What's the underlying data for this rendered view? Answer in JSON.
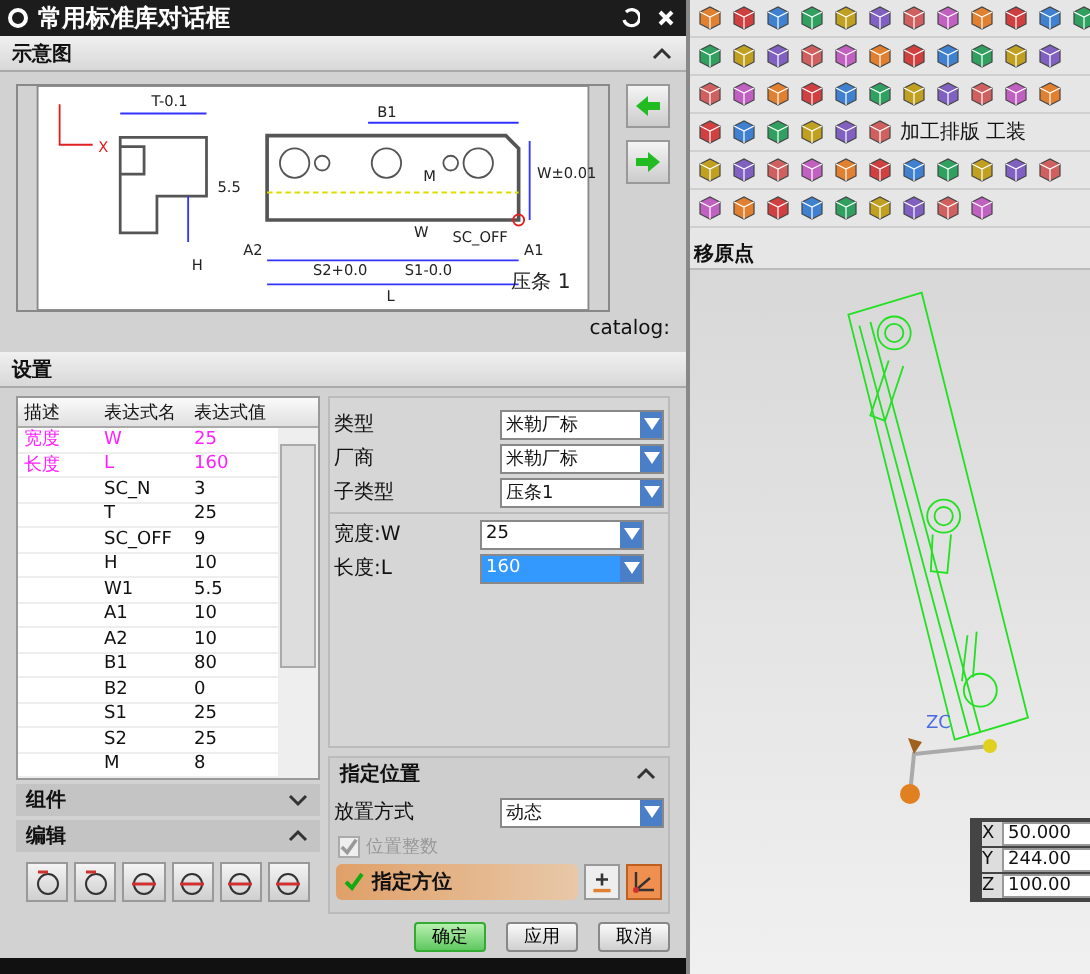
{
  "dialog": {
    "title": "常用标准库对话框"
  },
  "schematic": {
    "header": "示意图",
    "expanded": true,
    "labels": [
      "T-0.1",
      "B1",
      "M",
      "W",
      "A2",
      "A1",
      "S2+0.0",
      "S1-0.0",
      "L",
      "H",
      "5.5",
      "W±0.01",
      "SC_OFF",
      "X",
      "压条 1"
    ],
    "caption": "catalog:"
  },
  "settings": {
    "header": "设置",
    "columns": [
      "描述",
      "表达式名",
      "表达式值"
    ],
    "rows": [
      {
        "desc": "宽度",
        "name": "W",
        "value": "25",
        "highlighted": true
      },
      {
        "desc": "长度",
        "name": "L",
        "value": "160",
        "highlighted": true
      },
      {
        "desc": "",
        "name": "SC_N",
        "value": "3",
        "highlighted": false
      },
      {
        "desc": "",
        "name": "T",
        "value": "25",
        "highlighted": false
      },
      {
        "desc": "",
        "name": "SC_OFF",
        "value": "9",
        "highlighted": false
      },
      {
        "desc": "",
        "name": "H",
        "value": "10",
        "highlighted": false
      },
      {
        "desc": "",
        "name": "W1",
        "value": "5.5",
        "highlighted": false
      },
      {
        "desc": "",
        "name": "A1",
        "value": "10",
        "highlighted": false
      },
      {
        "desc": "",
        "name": "A2",
        "value": "10",
        "highlighted": false
      },
      {
        "desc": "",
        "name": "B1",
        "value": "80",
        "highlighted": false
      },
      {
        "desc": "",
        "name": "B2",
        "value": "0",
        "highlighted": false
      },
      {
        "desc": "",
        "name": "S1",
        "value": "25",
        "highlighted": false
      },
      {
        "desc": "",
        "name": "S2",
        "value": "25",
        "highlighted": false
      },
      {
        "desc": "",
        "name": "M",
        "value": "8",
        "highlighted": false
      }
    ]
  },
  "form": [
    {
      "kind": "select",
      "label": "类型",
      "value": "米勒厂标",
      "selected": false
    },
    {
      "kind": "select",
      "label": "厂商",
      "value": "米勒厂标",
      "selected": false
    },
    {
      "kind": "select",
      "label": "子类型",
      "value": "压条1",
      "selected": false
    },
    {
      "kind": "param",
      "label": "宽度:W",
      "value": "25",
      "selected": false
    },
    {
      "kind": "param",
      "label": "长度:L",
      "value": "160",
      "selected": true
    }
  ],
  "component": {
    "header": "组件",
    "expanded": false
  },
  "edit": {
    "header": "编辑",
    "expanded": true
  },
  "position": {
    "header": "指定位置",
    "expanded": true,
    "method_label": "放置方式",
    "method_value": "动态",
    "snap": {
      "label": "位置整数",
      "checked": true,
      "disabled": true
    },
    "orient": {
      "label": "指定方位",
      "done": true
    }
  },
  "buttons": [
    {
      "label": "确定",
      "primary": true
    },
    {
      "label": "应用",
      "primary": false
    },
    {
      "label": "取消",
      "primary": false
    }
  ],
  "toolbar": {
    "labels": [
      "加工排版",
      "工装"
    ]
  },
  "viewport": {
    "title": "移原点",
    "axis_label": "ZC",
    "coords": [
      {
        "axis": "X",
        "value": "50.000"
      },
      {
        "axis": "Y",
        "value": "244.00"
      },
      {
        "axis": "Z",
        "value": "100.00"
      }
    ]
  }
}
